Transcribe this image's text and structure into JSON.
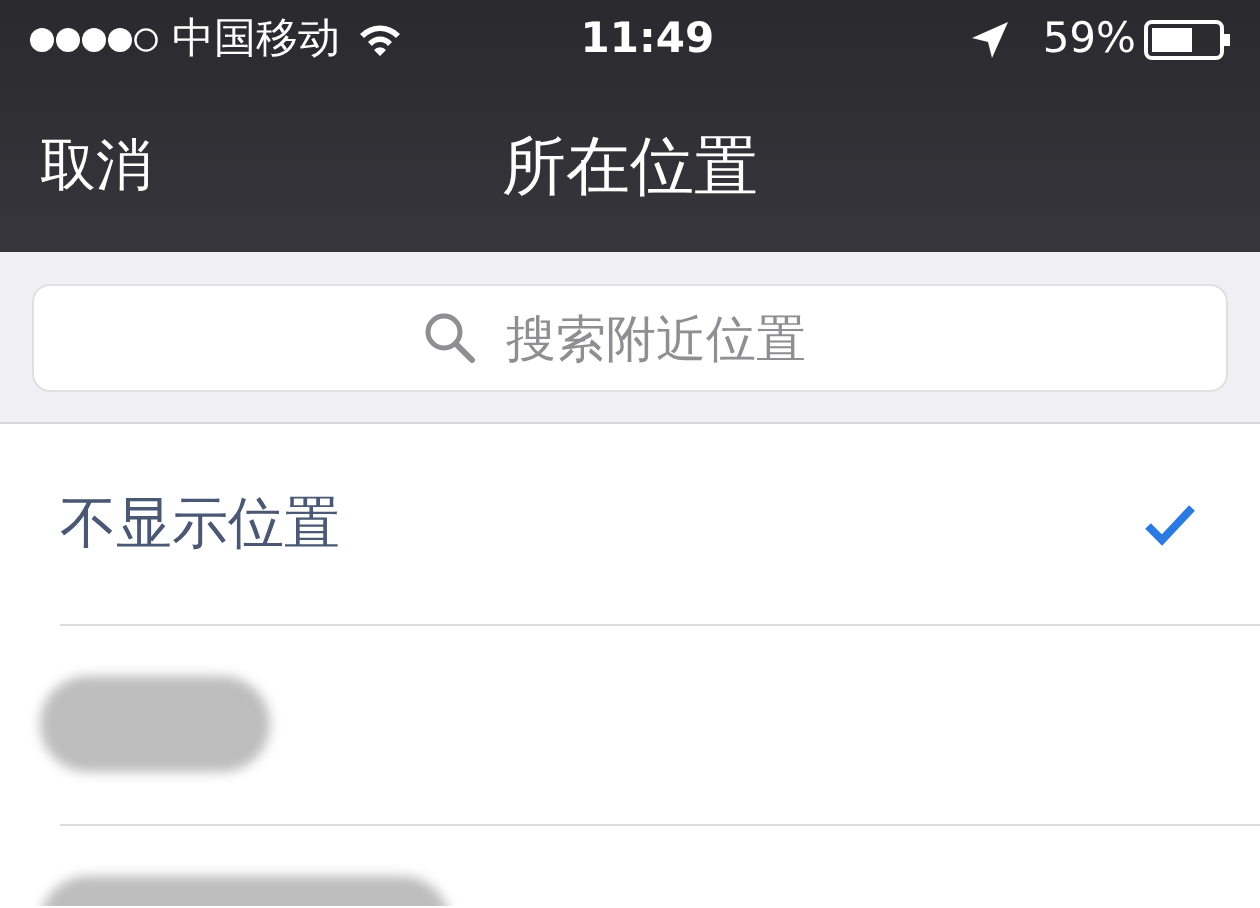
{
  "status_bar": {
    "carrier": "中国移动",
    "time": "11:49",
    "battery": "59%"
  },
  "nav": {
    "cancel": "取消",
    "title": "所在位置"
  },
  "search": {
    "placeholder": "搜索附近位置"
  },
  "locations": [
    {
      "kind": "label",
      "label": "不显示位置",
      "selected": true
    },
    {
      "kind": "redacted",
      "selected": false
    },
    {
      "kind": "redacted",
      "selected": false
    }
  ]
}
